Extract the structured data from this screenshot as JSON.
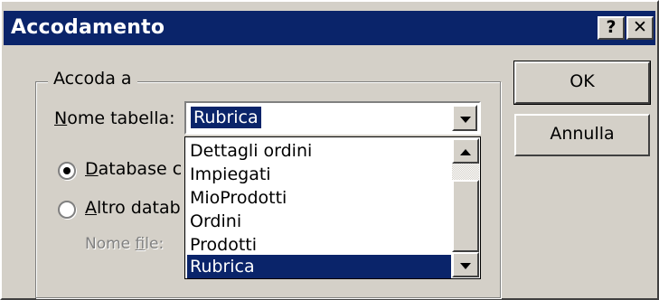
{
  "window": {
    "title": "Accodamento",
    "help_label": "?",
    "close_label": "✕"
  },
  "group": {
    "label": "Accoda a",
    "table_name_label_underlined": "N",
    "table_name_label_rest": "ome tabella:",
    "table_name_value": "Rubrica",
    "radio_current_underlined": "D",
    "radio_current_rest": "atabase c",
    "radio_other_underlined": "A",
    "radio_other_rest": "ltro datab",
    "file_name_label_prefix": "Nome ",
    "file_name_label_underlined": "f",
    "file_name_label_rest": "ile:"
  },
  "dropdown": {
    "items": [
      "Dettagli ordini",
      "Impiegati",
      "MioProdotti",
      "Ordini",
      "Prodotti",
      "Rubrica"
    ],
    "selected": "Rubrica"
  },
  "buttons": {
    "ok": "OK",
    "cancel": "Annulla"
  },
  "colors": {
    "titlebar": "#0a246a",
    "selection": "#0a246a",
    "face": "#d4d0c8"
  }
}
